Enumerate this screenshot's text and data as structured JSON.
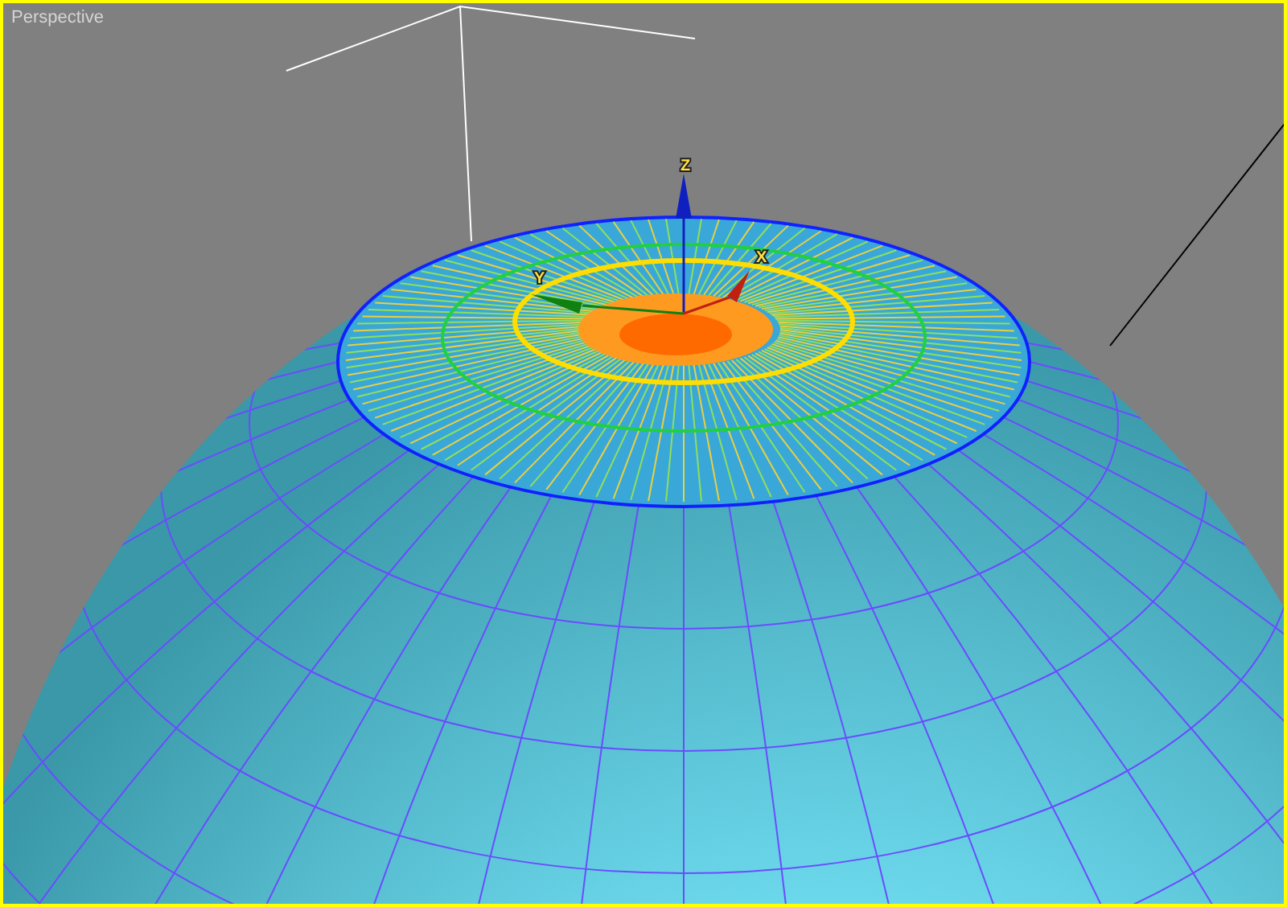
{
  "viewport": {
    "label": "Perspective",
    "active": true
  },
  "gizmo": {
    "axes": [
      {
        "label": "Z",
        "kind": "z"
      },
      {
        "label": "X",
        "kind": "x"
      },
      {
        "label": "Y",
        "kind": "y"
      }
    ]
  }
}
